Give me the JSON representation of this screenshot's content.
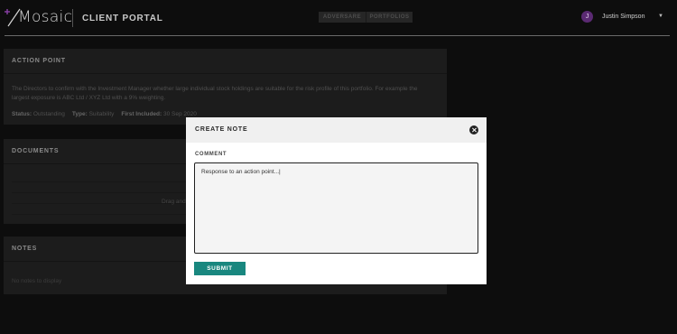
{
  "header": {
    "logo_text": "Mosaic",
    "portal_title": "CLIENT PORTAL",
    "tabs": [
      {
        "label": "ADVERSARE"
      },
      {
        "label": "PORTFOLIOS"
      }
    ],
    "user": {
      "initial": "J",
      "name": "Justin Simpson"
    }
  },
  "action_point": {
    "heading": "ACTION POINT",
    "description": "The Directors to confirm with the Investment Manager whether large individual stock holdings are suitable for the risk profile of this portfolio. For example the largest exposure is ABC Ltd / XYZ Ltd with a 9% weighting.",
    "status_label": "Status:",
    "status_value": "Outstanding",
    "type_label": "Type:",
    "type_value": "Suitability",
    "first_included_label": "First Included:",
    "first_included_value": "30 Sep 2020"
  },
  "documents": {
    "heading": "DOCUMENTS",
    "empty_text": "Drag and drop"
  },
  "notes": {
    "heading": "NOTES",
    "empty_text": "No notes to display"
  },
  "modal": {
    "title": "CREATE NOTE",
    "comment_label": "COMMENT",
    "comment_value": "Response to an action point...|",
    "submit_label": "SUBMIT"
  },
  "colors": {
    "accent": "#19877f",
    "avatar": "#5b2a73",
    "logo_mark": "#8a3fa8"
  },
  "icons": [
    "mosaic-logo-icon",
    "close-icon",
    "chevron-down-icon"
  ]
}
